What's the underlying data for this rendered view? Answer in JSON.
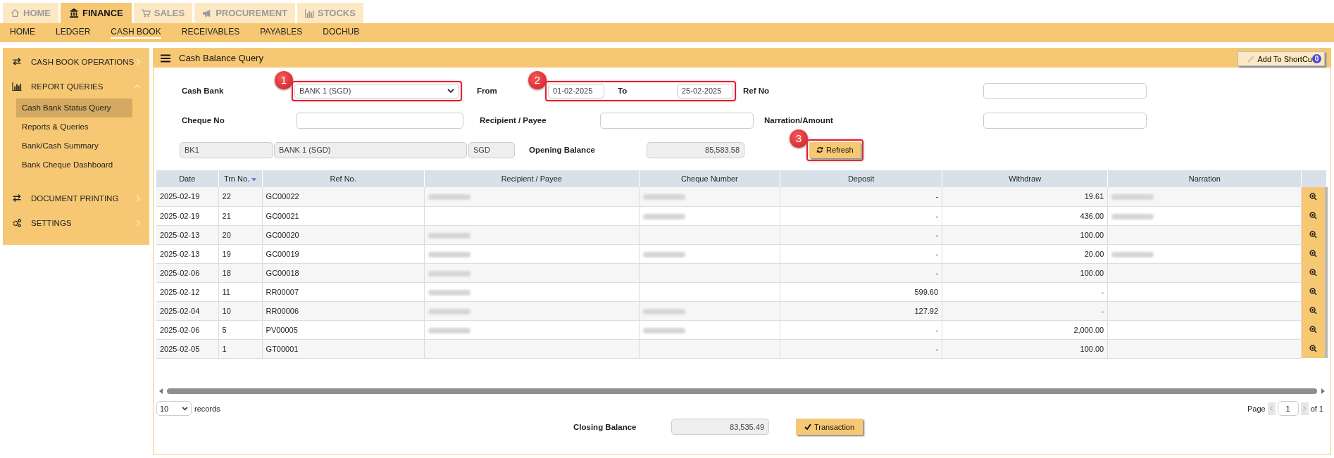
{
  "top_tabs": [
    {
      "label": "HOME",
      "kind": "home",
      "selected": false
    },
    {
      "label": "FINANCE",
      "kind": "bank",
      "selected": true
    },
    {
      "label": "SALES",
      "kind": "cart",
      "selected": false
    },
    {
      "label": "PROCUREMENT",
      "kind": "megaphone",
      "selected": false
    },
    {
      "label": "STOCKS",
      "kind": "chart",
      "selected": false
    }
  ],
  "sub_nav": [
    {
      "label": "HOME",
      "selected": false
    },
    {
      "label": "LEDGER",
      "selected": false
    },
    {
      "label": "CASH BOOK",
      "selected": true
    },
    {
      "label": "RECEIVABLES",
      "selected": false
    },
    {
      "label": "PAYABLES",
      "selected": false
    },
    {
      "label": "DOCHUB",
      "selected": false
    }
  ],
  "sidebar": {
    "groups": [
      {
        "label": "CASH BOOK OPERATIONS",
        "kind": "exchange",
        "expanded": false
      },
      {
        "label": "REPORT QUERIES",
        "kind": "chart",
        "expanded": true,
        "children": [
          {
            "label": "Cash Bank Status Query",
            "selected": true
          },
          {
            "label": "Reports & Queries",
            "selected": false
          },
          {
            "label": "Bank/Cash Summary",
            "selected": false
          },
          {
            "label": "Bank Cheque Dashboard",
            "selected": false
          }
        ]
      },
      {
        "label": "DOCUMENT PRINTING",
        "kind": "exchange",
        "expanded": false
      },
      {
        "label": "SETTINGS",
        "kind": "cogs",
        "expanded": false
      }
    ]
  },
  "panel": {
    "title": "Cash Balance Query",
    "shortcut": {
      "label": "Add To ShortCu",
      "count": "0"
    }
  },
  "form": {
    "cash_bank": {
      "label": "Cash Bank",
      "value": "BANK 1 (SGD)",
      "callout": "1"
    },
    "date_range": {
      "callout": "2",
      "from_label": "From",
      "from": "01-02-2025",
      "to_label": "To",
      "to": "25-02-2025"
    },
    "ref_no": {
      "label": "Ref No"
    },
    "cheque_no": {
      "label": "Cheque No"
    },
    "recipient": {
      "label": "Recipient / Payee"
    },
    "narration": {
      "label": "Narration/Amount"
    },
    "account": {
      "code": "BK1",
      "name": "BANK 1 (SGD)",
      "currency": "SGD"
    },
    "opening_balance": {
      "label": "Opening Balance",
      "value": "85,583.58"
    },
    "refresh": {
      "label": "Refresh",
      "callout": "3"
    }
  },
  "table": {
    "columns": [
      {
        "label": "Date",
        "sorted": false
      },
      {
        "label": "Trn No.",
        "sorted": true
      },
      {
        "label": "Ref No.",
        "sorted": false
      },
      {
        "label": "Recipient / Payee",
        "sorted": false
      },
      {
        "label": "Cheque Number",
        "sorted": false
      },
      {
        "label": "Deposit",
        "sorted": false
      },
      {
        "label": "Withdraw",
        "sorted": false
      },
      {
        "label": "Narration",
        "sorted": false
      }
    ],
    "rows": [
      {
        "date": "2025-02-19",
        "trn": "22",
        "ref": "GC00022",
        "recipient_blurred": true,
        "cheque_blurred": true,
        "deposit": "-",
        "withdraw": "19.61",
        "narration_blurred": true
      },
      {
        "date": "2025-02-19",
        "trn": "21",
        "ref": "GC00021",
        "recipient_blurred": false,
        "cheque_blurred": true,
        "deposit": "-",
        "withdraw": "436.00",
        "narration_blurred": true
      },
      {
        "date": "2025-02-13",
        "trn": "20",
        "ref": "GC00020",
        "recipient_blurred": true,
        "cheque_blurred": false,
        "deposit": "-",
        "withdraw": "100.00",
        "narration_blurred": false
      },
      {
        "date": "2025-02-13",
        "trn": "19",
        "ref": "GC00019",
        "recipient_blurred": true,
        "cheque_blurred": true,
        "deposit": "-",
        "withdraw": "20.00",
        "narration_blurred": true
      },
      {
        "date": "2025-02-06",
        "trn": "18",
        "ref": "GC00018",
        "recipient_blurred": true,
        "cheque_blurred": false,
        "deposit": "-",
        "withdraw": "100.00",
        "narration_blurred": false
      },
      {
        "date": "2025-02-12",
        "trn": "11",
        "ref": "RR00007",
        "recipient_blurred": true,
        "cheque_blurred": false,
        "deposit": "599.60",
        "withdraw": "-",
        "narration_blurred": false
      },
      {
        "date": "2025-02-04",
        "trn": "10",
        "ref": "RR00006",
        "recipient_blurred": true,
        "cheque_blurred": true,
        "deposit": "127.92",
        "withdraw": "-",
        "narration_blurred": false
      },
      {
        "date": "2025-02-06",
        "trn": "5",
        "ref": "PV00005",
        "recipient_blurred": true,
        "cheque_blurred": true,
        "deposit": "-",
        "withdraw": "2,000.00",
        "narration_blurred": false
      },
      {
        "date": "2025-02-05",
        "trn": "1",
        "ref": "GT00001",
        "recipient_blurred": false,
        "cheque_blurred": false,
        "deposit": "-",
        "withdraw": "100.00",
        "narration_blurred": false
      }
    ]
  },
  "footer": {
    "page_size": "10",
    "records_label": "records",
    "page_label": "Page",
    "page": "1",
    "page_of": "of 1",
    "closing_balance": {
      "label": "Closing Balance",
      "value": "83,535.49"
    },
    "transaction_button": "Transaction"
  }
}
